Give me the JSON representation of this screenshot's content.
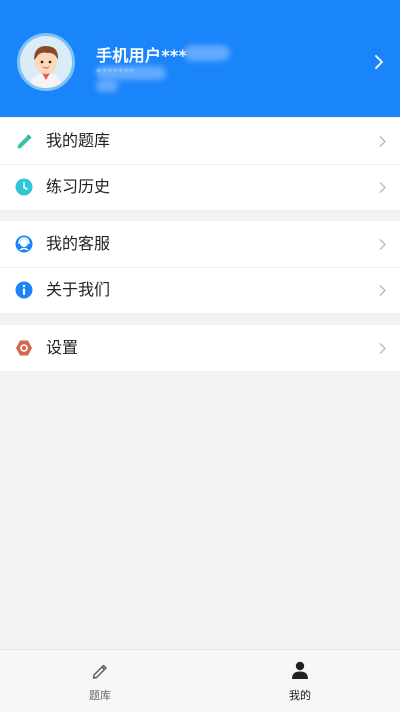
{
  "header": {
    "user_name": "手机用户***",
    "user_phone": "*******"
  },
  "menu": {
    "group1": [
      {
        "label": "我的题库",
        "icon": "pencil-icon"
      },
      {
        "label": "练习历史",
        "icon": "clock-icon"
      }
    ],
    "group2": [
      {
        "label": "我的客服",
        "icon": "headset-icon"
      },
      {
        "label": "关于我们",
        "icon": "info-icon"
      }
    ],
    "group3": [
      {
        "label": "设置",
        "icon": "settings-hexagon-icon"
      }
    ]
  },
  "tabbar": {
    "tabs": [
      {
        "label": "题库",
        "icon": "pencil-outline-icon",
        "active": false
      },
      {
        "label": "我的",
        "icon": "person-icon",
        "active": true
      }
    ]
  },
  "colors": {
    "header_bg": "#1a84fa",
    "pencil": "#3bc3a5",
    "clock": "#2fc7d8",
    "info": "#1a84fa",
    "settings": "#d8664e"
  }
}
